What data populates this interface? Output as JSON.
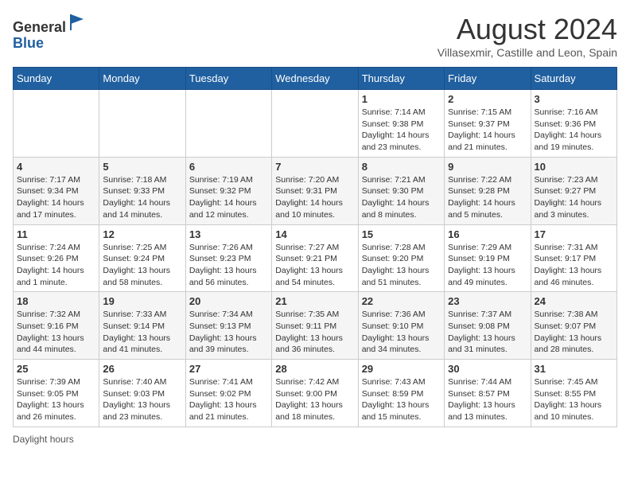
{
  "header": {
    "logo_general": "General",
    "logo_blue": "Blue",
    "month_title": "August 2024",
    "subtitle": "Villasexmir, Castille and Leon, Spain"
  },
  "days_of_week": [
    "Sunday",
    "Monday",
    "Tuesday",
    "Wednesday",
    "Thursday",
    "Friday",
    "Saturday"
  ],
  "weeks": [
    [
      {
        "day": "",
        "info": ""
      },
      {
        "day": "",
        "info": ""
      },
      {
        "day": "",
        "info": ""
      },
      {
        "day": "",
        "info": ""
      },
      {
        "day": "1",
        "info": "Sunrise: 7:14 AM\nSunset: 9:38 PM\nDaylight: 14 hours\nand 23 minutes."
      },
      {
        "day": "2",
        "info": "Sunrise: 7:15 AM\nSunset: 9:37 PM\nDaylight: 14 hours\nand 21 minutes."
      },
      {
        "day": "3",
        "info": "Sunrise: 7:16 AM\nSunset: 9:36 PM\nDaylight: 14 hours\nand 19 minutes."
      }
    ],
    [
      {
        "day": "4",
        "info": "Sunrise: 7:17 AM\nSunset: 9:34 PM\nDaylight: 14 hours\nand 17 minutes."
      },
      {
        "day": "5",
        "info": "Sunrise: 7:18 AM\nSunset: 9:33 PM\nDaylight: 14 hours\nand 14 minutes."
      },
      {
        "day": "6",
        "info": "Sunrise: 7:19 AM\nSunset: 9:32 PM\nDaylight: 14 hours\nand 12 minutes."
      },
      {
        "day": "7",
        "info": "Sunrise: 7:20 AM\nSunset: 9:31 PM\nDaylight: 14 hours\nand 10 minutes."
      },
      {
        "day": "8",
        "info": "Sunrise: 7:21 AM\nSunset: 9:30 PM\nDaylight: 14 hours\nand 8 minutes."
      },
      {
        "day": "9",
        "info": "Sunrise: 7:22 AM\nSunset: 9:28 PM\nDaylight: 14 hours\nand 5 minutes."
      },
      {
        "day": "10",
        "info": "Sunrise: 7:23 AM\nSunset: 9:27 PM\nDaylight: 14 hours\nand 3 minutes."
      }
    ],
    [
      {
        "day": "11",
        "info": "Sunrise: 7:24 AM\nSunset: 9:26 PM\nDaylight: 14 hours\nand 1 minute."
      },
      {
        "day": "12",
        "info": "Sunrise: 7:25 AM\nSunset: 9:24 PM\nDaylight: 13 hours\nand 58 minutes."
      },
      {
        "day": "13",
        "info": "Sunrise: 7:26 AM\nSunset: 9:23 PM\nDaylight: 13 hours\nand 56 minutes."
      },
      {
        "day": "14",
        "info": "Sunrise: 7:27 AM\nSunset: 9:21 PM\nDaylight: 13 hours\nand 54 minutes."
      },
      {
        "day": "15",
        "info": "Sunrise: 7:28 AM\nSunset: 9:20 PM\nDaylight: 13 hours\nand 51 minutes."
      },
      {
        "day": "16",
        "info": "Sunrise: 7:29 AM\nSunset: 9:19 PM\nDaylight: 13 hours\nand 49 minutes."
      },
      {
        "day": "17",
        "info": "Sunrise: 7:31 AM\nSunset: 9:17 PM\nDaylight: 13 hours\nand 46 minutes."
      }
    ],
    [
      {
        "day": "18",
        "info": "Sunrise: 7:32 AM\nSunset: 9:16 PM\nDaylight: 13 hours\nand 44 minutes."
      },
      {
        "day": "19",
        "info": "Sunrise: 7:33 AM\nSunset: 9:14 PM\nDaylight: 13 hours\nand 41 minutes."
      },
      {
        "day": "20",
        "info": "Sunrise: 7:34 AM\nSunset: 9:13 PM\nDaylight: 13 hours\nand 39 minutes."
      },
      {
        "day": "21",
        "info": "Sunrise: 7:35 AM\nSunset: 9:11 PM\nDaylight: 13 hours\nand 36 minutes."
      },
      {
        "day": "22",
        "info": "Sunrise: 7:36 AM\nSunset: 9:10 PM\nDaylight: 13 hours\nand 34 minutes."
      },
      {
        "day": "23",
        "info": "Sunrise: 7:37 AM\nSunset: 9:08 PM\nDaylight: 13 hours\nand 31 minutes."
      },
      {
        "day": "24",
        "info": "Sunrise: 7:38 AM\nSunset: 9:07 PM\nDaylight: 13 hours\nand 28 minutes."
      }
    ],
    [
      {
        "day": "25",
        "info": "Sunrise: 7:39 AM\nSunset: 9:05 PM\nDaylight: 13 hours\nand 26 minutes."
      },
      {
        "day": "26",
        "info": "Sunrise: 7:40 AM\nSunset: 9:03 PM\nDaylight: 13 hours\nand 23 minutes."
      },
      {
        "day": "27",
        "info": "Sunrise: 7:41 AM\nSunset: 9:02 PM\nDaylight: 13 hours\nand 21 minutes."
      },
      {
        "day": "28",
        "info": "Sunrise: 7:42 AM\nSunset: 9:00 PM\nDaylight: 13 hours\nand 18 minutes."
      },
      {
        "day": "29",
        "info": "Sunrise: 7:43 AM\nSunset: 8:59 PM\nDaylight: 13 hours\nand 15 minutes."
      },
      {
        "day": "30",
        "info": "Sunrise: 7:44 AM\nSunset: 8:57 PM\nDaylight: 13 hours\nand 13 minutes."
      },
      {
        "day": "31",
        "info": "Sunrise: 7:45 AM\nSunset: 8:55 PM\nDaylight: 13 hours\nand 10 minutes."
      }
    ]
  ],
  "footer": {
    "daylight_label": "Daylight hours"
  }
}
